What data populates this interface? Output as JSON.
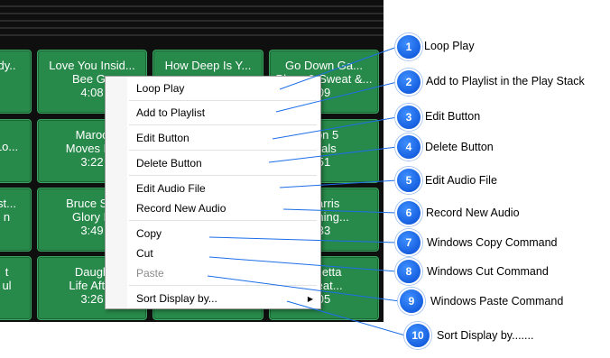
{
  "tiles": [
    {
      "lines": [
        "dy..",
        ""
      ]
    },
    {
      "lines": [
        "Love You Insid...",
        "Bee Ge",
        "4:08"
      ]
    },
    {
      "lines": [
        "How Deep Is Y...",
        "",
        ""
      ]
    },
    {
      "lines": [
        "Go Down Ga...",
        "Plays & Sweat &...",
        "09"
      ]
    },
    {
      "lines": [
        "",
        "Lo..."
      ]
    },
    {
      "lines": [
        "Maroo",
        "Moves Lik",
        "3:22"
      ]
    },
    {
      "lines": [
        "",
        ""
      ]
    },
    {
      "lines": [
        "oon 5",
        "mals",
        "51"
      ]
    },
    {
      "lines": [
        "st...",
        "n"
      ]
    },
    {
      "lines": [
        "Bruce Spr",
        "Glory D",
        "3:49"
      ]
    },
    {
      "lines": [
        "",
        ""
      ]
    },
    {
      "lines": [
        "Harris",
        "Nothing...",
        "33"
      ]
    },
    {
      "lines": [
        "t",
        "ul"
      ]
    },
    {
      "lines": [
        "Daugh",
        "Life After",
        "3:26"
      ]
    },
    {
      "lines": [
        "",
        ""
      ]
    },
    {
      "lines": [
        "Guetta",
        "(Feat...",
        "05"
      ]
    }
  ],
  "menu": {
    "items": [
      {
        "label": "Loop Play"
      },
      {
        "label": "Add to Playlist"
      },
      {
        "label": "Edit Button"
      },
      {
        "label": "Delete Button"
      },
      {
        "label": "Edit Audio File"
      },
      {
        "label": "Record New Audio"
      },
      {
        "label": "Copy"
      },
      {
        "label": "Cut"
      },
      {
        "label": "Paste"
      },
      {
        "label": "Sort Display by..."
      }
    ],
    "submenu_arrow": "▶"
  },
  "callouts": [
    {
      "number": "1",
      "label": "Loop Play"
    },
    {
      "number": "2",
      "label": "Add to Playlist in the Play Stack"
    },
    {
      "number": "3",
      "label": "Edit Button"
    },
    {
      "number": "4",
      "label": "Delete Button"
    },
    {
      "number": "5",
      "label": "Edit Audio File"
    },
    {
      "number": "6",
      "label": "Record New Audio"
    },
    {
      "number": "7",
      "label": "Windows Copy Command"
    },
    {
      "number": "8",
      "label": "Windows Cut Command"
    },
    {
      "number": "9",
      "label": "Windows Paste Command"
    },
    {
      "number": "10",
      "label": "Sort Display by......."
    }
  ],
  "colors": {
    "tile": "#27894a",
    "badge": "#1a6fe8",
    "panel": "#0f0f0f"
  }
}
